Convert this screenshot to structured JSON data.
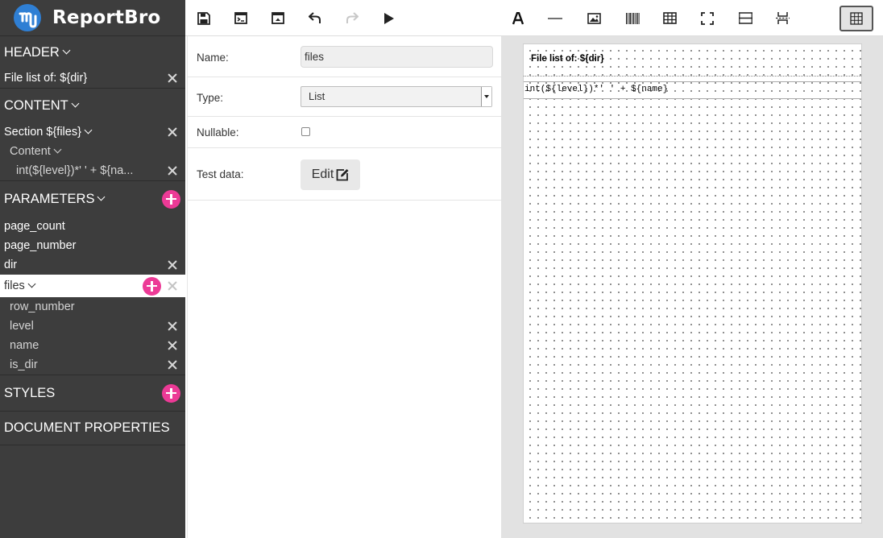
{
  "app": {
    "title": "ReportBro"
  },
  "sidebar": {
    "header": {
      "label": "HEADER",
      "items": [
        {
          "label": "File list of: ${dir}"
        }
      ]
    },
    "content": {
      "label": "CONTENT",
      "section_label": "Section ${files}",
      "content_label": "Content",
      "field_label": "int(${level})*' ' + ${na..."
    },
    "parameters": {
      "label": "PARAMETERS",
      "items": [
        {
          "label": "page_count"
        },
        {
          "label": "page_number"
        },
        {
          "label": "dir"
        },
        {
          "label": "files"
        }
      ],
      "files_children": [
        {
          "label": "row_number"
        },
        {
          "label": "level"
        },
        {
          "label": "name"
        },
        {
          "label": "is_dir"
        }
      ]
    },
    "styles": {
      "label": "STYLES"
    },
    "document_properties": {
      "label": "DOCUMENT PROPERTIES"
    }
  },
  "detail": {
    "name_label": "Name:",
    "name_value": "files",
    "type_label": "Type:",
    "type_value": "List",
    "nullable_label": "Nullable:",
    "test_data_label": "Test data:",
    "edit_label": "Edit"
  },
  "document": {
    "header_text": "File list of: ${dir}",
    "content_text": "int(${level})*'     ' + ${name}"
  },
  "icons": {
    "toolbar": [
      "save-icon",
      "preview-pdf-icon",
      "preview-xlsx-icon",
      "undo-icon",
      "redo-icon",
      "play-icon",
      "text-icon",
      "line-icon",
      "image-icon",
      "barcode-icon",
      "table-icon",
      "frame-icon",
      "section-icon",
      "page-break-icon",
      "grid-icon"
    ]
  },
  "colors": {
    "sidebar_bg": "#3d3d3d",
    "accent": "#ec3a96",
    "logo_blue": "#2f7fd4"
  }
}
